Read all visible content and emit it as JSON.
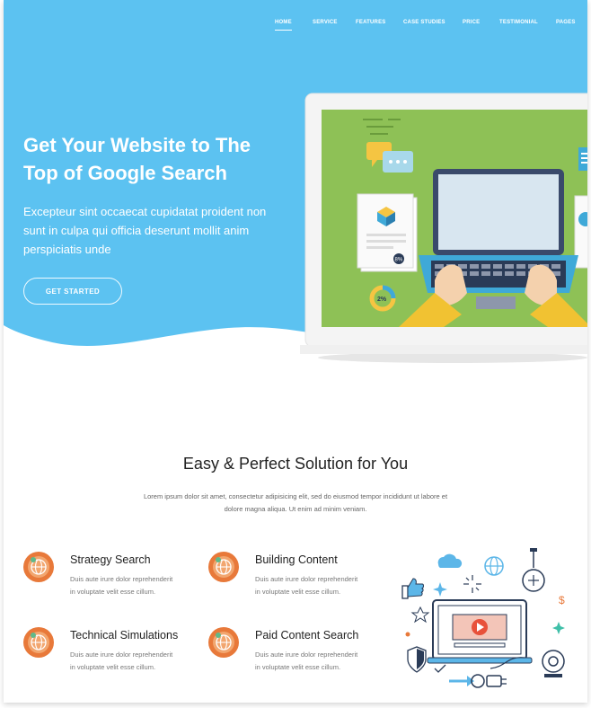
{
  "nav": {
    "items": [
      "HOME",
      "SERVICE",
      "FEATURES",
      "CASE STUDIES",
      "PRICE",
      "TESTIMONIAL",
      "PAGES"
    ],
    "active": "HOME"
  },
  "hero": {
    "title_line1": "Get Your Website to The",
    "title_line2": "Top of Google Search",
    "text": "Excepteur sint occaecat cupidatat proident non sunt in culpa qui officia deserunt mollit anim perspiciatis unde",
    "cta": "GET STARTED",
    "badge_top": "8%",
    "badge_bottom": "2%"
  },
  "section": {
    "title": "Easy & Perfect Solution for You",
    "text_line1": "Lorem ipsum dolor sit amet, consectetur adipisicing elit, sed do eiusmod tempor incididunt ut labore et",
    "text_line2": "dolore magna aliqua. Ut enim ad minim veniam."
  },
  "features": [
    {
      "title": "Strategy Search",
      "desc_line1": "Duis aute irure dolor reprehenderit",
      "desc_line2": "in voluptate velit esse cillum.",
      "icon": "globe-icon"
    },
    {
      "title": "Building Content",
      "desc_line1": "Duis aute irure dolor reprehenderit",
      "desc_line2": "in voluptate velit esse cillum.",
      "icon": "globe-icon"
    },
    {
      "title": "Technical Simulations",
      "desc_line1": "Duis aute irure dolor reprehenderit",
      "desc_line2": "in voluptate velit esse cillum.",
      "icon": "globe-icon"
    },
    {
      "title": "Paid Content Search",
      "desc_line1": "Duis aute irure dolor reprehenderit",
      "desc_line2": "in voluptate velit esse cillum.",
      "icon": "globe-icon"
    }
  ],
  "colors": {
    "hero_blue": "#5bc1f0",
    "accent_orange": "#e8793a",
    "screen_green": "#8dc056"
  }
}
